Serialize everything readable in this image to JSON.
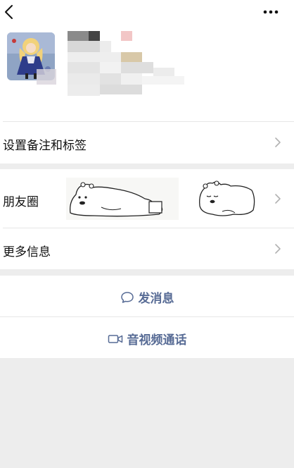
{
  "nav": {
    "back_icon": "chevron-left-icon",
    "more_icon": "ellipsis-icon"
  },
  "profile": {
    "avatar_icon": "anime-girl-avatar",
    "name_redacted": true
  },
  "rows": {
    "remark_label": "设置备注和标签",
    "moments_label": "朋友圈",
    "more_info_label": "更多信息"
  },
  "actions": {
    "message_label": "发消息",
    "message_icon": "chat-bubble-icon",
    "call_label": "音视频通话",
    "call_icon": "video-camera-icon"
  },
  "colors": {
    "link_blue": "#576b95",
    "background": "#ededed",
    "card": "#ffffff"
  }
}
